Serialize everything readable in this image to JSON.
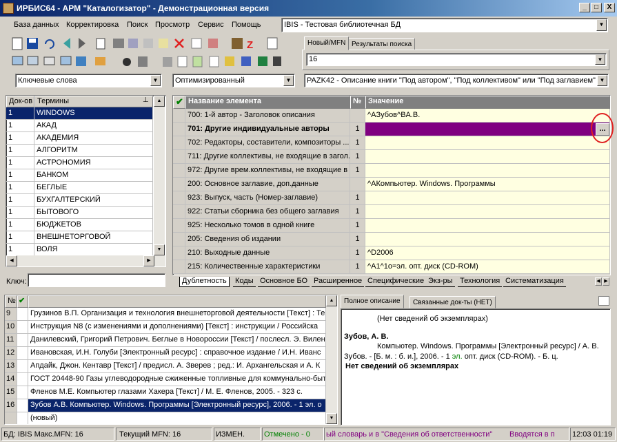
{
  "window": {
    "title": "ИРБИС64 - АРМ \"Каталогизатор\" - Демонстрационная версия",
    "min": "_",
    "max": "□",
    "close": "X"
  },
  "menu": [
    "База данных",
    "Корректировка",
    "Поиск",
    "Просмотр",
    "Сервис",
    "Помощь"
  ],
  "database": {
    "value": "IBIS - Тестовая библиотечная БД"
  },
  "right_tabs": [
    "Новый/MFN",
    "Результаты поиска"
  ],
  "mfn_input": "16",
  "search_mode": "Ключевые слова",
  "optim_mode": "Оптимизированный",
  "worksheet": "PAZK42 - Описание книги \"Под автором\", \"Под коллективом\" или \"Под заглавием\"",
  "terms": {
    "headers": [
      "Док-ов",
      "Термины"
    ],
    "rows": [
      [
        "1",
        "WINDOWS"
      ],
      [
        "1",
        "АКАД"
      ],
      [
        "1",
        "АКАДЕМИЯ"
      ],
      [
        "1",
        "АЛГОРИТМ"
      ],
      [
        "1",
        "АСТРОНОМИЯ"
      ],
      [
        "1",
        "БАНКОМ"
      ],
      [
        "1",
        "БЕГЛЫЕ"
      ],
      [
        "1",
        "БУХГАЛТЕРСКИЙ"
      ],
      [
        "1",
        "БЫТОВОГО"
      ],
      [
        "1",
        "БЮДЖЕТОВ"
      ],
      [
        "1",
        "ВНЕШНЕТОРГОВОЙ"
      ],
      [
        "1",
        "ВОЛЯ"
      ]
    ],
    "key_label": "Ключ:"
  },
  "fields": {
    "headers": [
      "Название элемента",
      "№",
      "Значение"
    ],
    "rows": [
      [
        "700: 1-й автор - Заголовок описания",
        "",
        "^AЗубов^BA.B."
      ],
      [
        "701: Другие индивидуальные авторы",
        "1",
        ""
      ],
      [
        "702: Редакторы, составители, композиторы ...",
        "1",
        ""
      ],
      [
        "711: Другие коллективы, не входящие в загол...",
        "1",
        ""
      ],
      [
        "972: Другие врем.коллективы, не входящие в",
        "1",
        ""
      ],
      [
        "200: Основное заглавие, доп.данные",
        "",
        "^AКомпьютер. Windows. Программы"
      ],
      [
        "923: Выпуск, часть (Номер-заглавие)",
        "1",
        ""
      ],
      [
        "922: Статьи сборника без общего заглавия",
        "1",
        ""
      ],
      [
        "925: Несколько томов в одной книге",
        "1",
        ""
      ],
      [
        "205: Сведения об издании",
        "1",
        ""
      ],
      [
        "210: Выходные данные",
        "1",
        "^D2006"
      ],
      [
        "215: Количественные характеристики",
        "1",
        "^A1^1o=эл. опт. диск (CD-ROM)"
      ]
    ],
    "ellipsis": "..."
  },
  "bottom_tabs": [
    "Дублетность",
    "Коды",
    "Основное БО",
    "Расширенное",
    "Специфические",
    "Экз-ры",
    "Технология",
    "Систематизация"
  ],
  "records": {
    "header_no": "№",
    "rows": [
      [
        "9",
        "Грузинов В.П. Организация и технология внешнеторговой деятельности [Текст] : Те"
      ],
      [
        "10",
        "Инструкция N8   (с изменениями и дополнениями) [Текст] : инструкции / Российска"
      ],
      [
        "11",
        "Данилевский, Григорий Петрович. Беглые в Новороссии [Текст] / послесл. Э. Вилен"
      ],
      [
        "12",
        "Ивановская, И.Н. Голуби [Электронный ресурс] : справочное издание / И.Н. Иванс"
      ],
      [
        "13",
        "Апдайк, Джон. Кентавр [Текст] / предисл. А. Зверев ; ред.: И. Архангельская и А. К"
      ],
      [
        "14",
        "ГОСТ 20448-90 Газы углеводородные сжиженные топливные для коммунально-быт"
      ],
      [
        "15",
        "Фленов М.Е. Компьютер глазами Хакера [Текст] / М. Е. Фленов, 2005. - 323 с."
      ],
      [
        "16",
        "Зубов А.В. Компьютер. Windows. Программы [Электронный ресурс], 2006. - 1 эл. о"
      ],
      [
        "",
        "(новый)"
      ]
    ]
  },
  "desc_tabs": [
    "Полное описание",
    "Связанные док-ты (НЕТ)"
  ],
  "description": {
    "line1": "(Нет сведений об экземплярах)",
    "author": "Зубов, А. В.",
    "body1": "Компьютер. Windows. Программы [Электронный ресурс] / А. В.",
    "body2a": "Зубов. - [Б. м. : б. и.], 2006. - 1 ",
    "body2b": "эл.",
    "body2c": " опт. диск (CD-ROM). - Б. ц.",
    "line_end": "Нет сведений об экземплярах"
  },
  "status": {
    "bd": "БД: IBIS Макс.MFN: 16",
    "cur": "Текущий MFN: 16",
    "changed": "ИЗМЕН.",
    "marked": "Отмечено - 0",
    "hint": "ый словарь и в \"Сведения об ответственности\"",
    "entered": "Вводятся в п",
    "time": "12:03 01:19"
  },
  "colors": {
    "selection": "#0a246a",
    "highlight_row": "#800080",
    "value_bg": "#ffffe1",
    "marked": "#008000",
    "hint": "#800080"
  }
}
